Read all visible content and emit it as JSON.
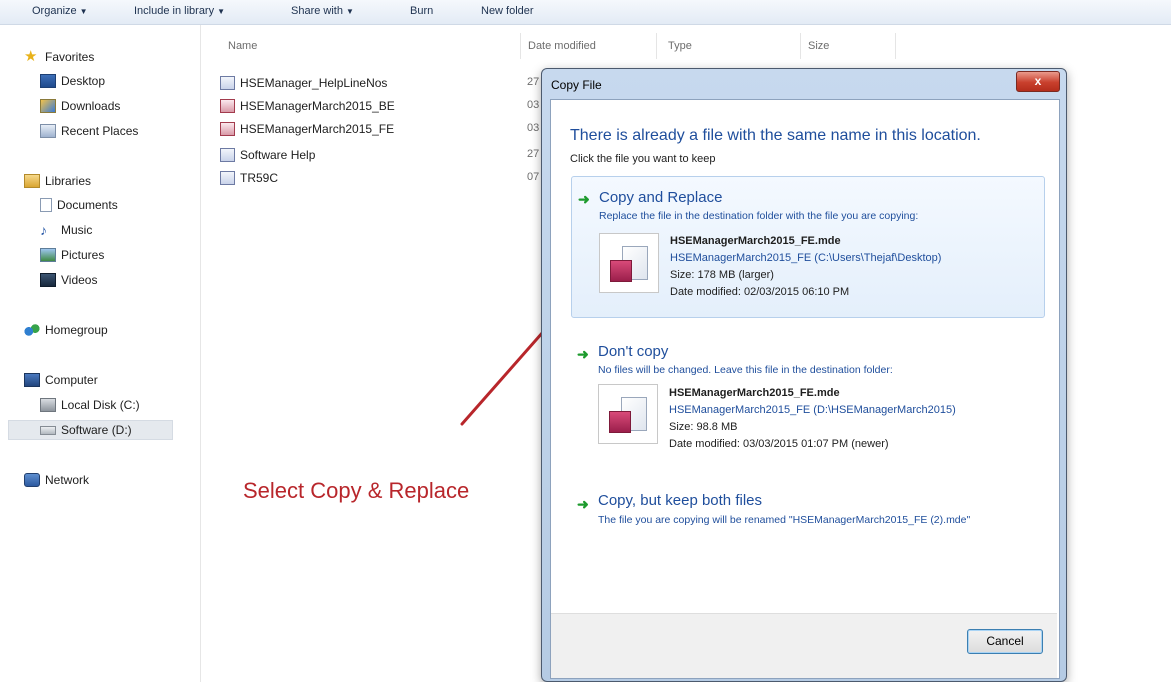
{
  "toolbar": {
    "organize": "Organize",
    "include_in_library": "Include in library",
    "share_with": "Share with",
    "burn": "Burn",
    "new_folder": "New folder"
  },
  "nav": {
    "favorites": "Favorites",
    "desktop": "Desktop",
    "downloads": "Downloads",
    "recent_places": "Recent Places",
    "libraries": "Libraries",
    "documents": "Documents",
    "music": "Music",
    "pictures": "Pictures",
    "videos": "Videos",
    "homegroup": "Homegroup",
    "computer": "Computer",
    "local_disk": "Local Disk (C:)",
    "software_drive": "Software (D:)",
    "network": "Network"
  },
  "columns": {
    "name": "Name",
    "date_modified": "Date modified",
    "type": "Type",
    "size": "Size"
  },
  "files": [
    {
      "name": "HSEManager_HelpLineNos",
      "date": "27"
    },
    {
      "name": "HSEManagerMarch2015_BE",
      "date": "03"
    },
    {
      "name": "HSEManagerMarch2015_FE",
      "date": "03"
    },
    {
      "name": "Software Help",
      "date": "27"
    },
    {
      "name": "TR59C",
      "date": "07"
    }
  ],
  "annotation": "Select Copy & Replace",
  "dialog": {
    "title": "Copy File",
    "close_label": "x",
    "heading": "There is already a file with the same name in this location.",
    "subheading": "Click the file you want to keep",
    "option_replace": {
      "title": "Copy and Replace",
      "description": "Replace the file in the destination folder with the file you are copying:",
      "file_name": "HSEManagerMarch2015_FE.mde",
      "file_path": "HSEManagerMarch2015_FE (C:\\Users\\Thejaf\\Desktop)",
      "size": "Size: 178 MB (larger)",
      "date_modified": "Date modified: 02/03/2015 06:10 PM"
    },
    "option_dont_copy": {
      "title": "Don't copy",
      "description": "No files will be changed. Leave this file in the destination folder:",
      "file_name": "HSEManagerMarch2015_FE.mde",
      "file_path": "HSEManagerMarch2015_FE (D:\\HSEManagerMarch2015)",
      "size": "Size: 98.8 MB",
      "date_modified": "Date modified: 03/03/2015 01:07 PM (newer)"
    },
    "option_keep_both": {
      "title": "Copy, but keep both files",
      "description": "The file you are copying will be renamed \"HSEManagerMarch2015_FE (2).mde\""
    },
    "cancel_label": "Cancel"
  },
  "colors": {
    "heading_blue": "#1f4e9c",
    "annotation_red": "#b8262b",
    "green_arrow": "#1e9b2e"
  }
}
